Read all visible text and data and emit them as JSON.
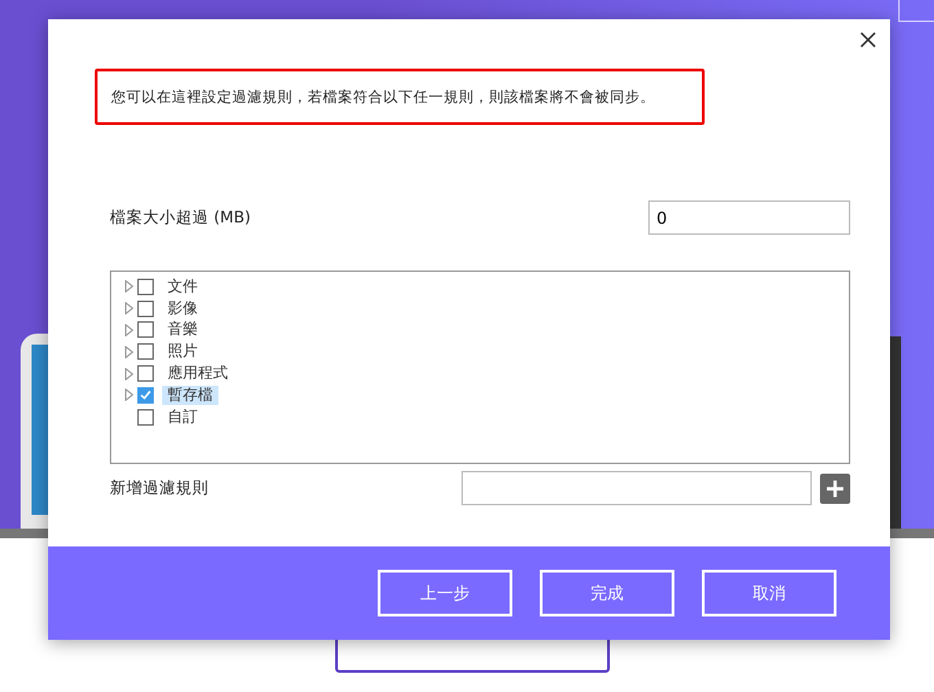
{
  "dialog": {
    "notice": "您可以在這裡設定過濾規則，若檔案符合以下任一規則，則該檔案將不會被同步。",
    "size_label": "檔案大小超過 (MB)",
    "size_value": "0",
    "categories": [
      {
        "label": "文件",
        "expandable": true,
        "checked": false,
        "selected": false
      },
      {
        "label": "影像",
        "expandable": true,
        "checked": false,
        "selected": false
      },
      {
        "label": "音樂",
        "expandable": true,
        "checked": false,
        "selected": false
      },
      {
        "label": "照片",
        "expandable": true,
        "checked": false,
        "selected": false
      },
      {
        "label": "應用程式",
        "expandable": true,
        "checked": false,
        "selected": false
      },
      {
        "label": "暫存檔",
        "expandable": true,
        "checked": true,
        "selected": true
      },
      {
        "label": "自訂",
        "expandable": false,
        "checked": false,
        "selected": false
      }
    ],
    "new_rule_label": "新增過濾規則",
    "buttons": [
      "上一步",
      "完成",
      "取消"
    ]
  }
}
